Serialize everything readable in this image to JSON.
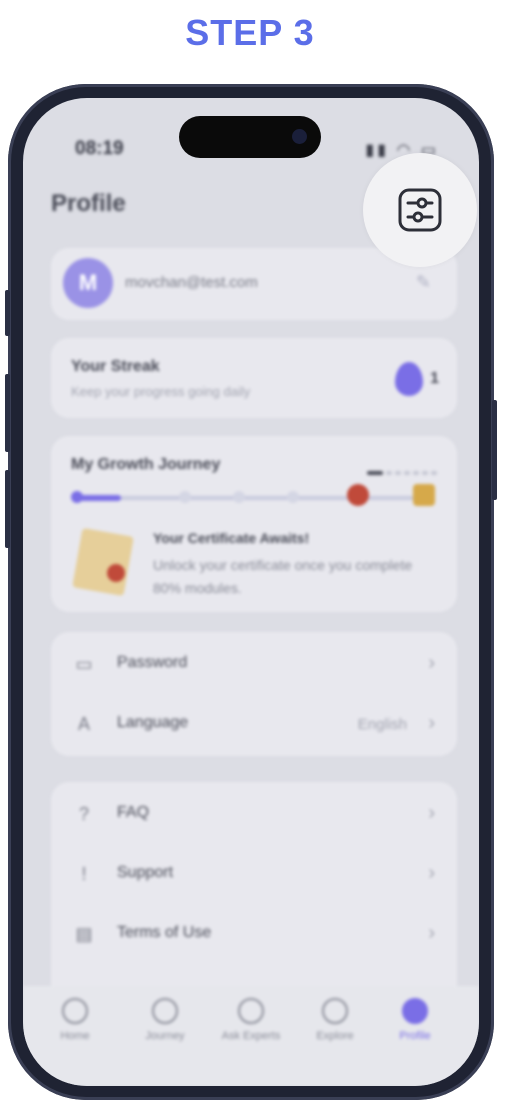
{
  "header": {
    "step_label": "STEP 3"
  },
  "status_bar": {
    "time": "08:19",
    "indicators": "signal wifi battery"
  },
  "profile": {
    "title": "Profile",
    "avatar_letter": "M",
    "email": "movchan@test.com"
  },
  "streak": {
    "title": "Your Streak",
    "subtitle": "Keep your progress going daily",
    "count": "1"
  },
  "growth": {
    "title": "My Growth Journey",
    "progress_fraction": 0.13,
    "certificate_title": "Your Certificate Awaits!",
    "certificate_text": "Unlock your certificate once you complete 80% modules."
  },
  "settings": {
    "items": [
      {
        "label": "Password",
        "icon": "password-icon",
        "value": ""
      },
      {
        "label": "Language",
        "icon": "translate-icon",
        "value": "English"
      }
    ]
  },
  "help": {
    "items": [
      {
        "label": "FAQ",
        "icon": "question-icon"
      },
      {
        "label": "Support",
        "icon": "support-icon"
      },
      {
        "label": "Terms of Use",
        "icon": "document-icon"
      }
    ]
  },
  "tabbar": {
    "tabs": [
      {
        "label": "Home",
        "icon": "home-icon"
      },
      {
        "label": "Journey",
        "icon": "journey-icon"
      },
      {
        "label": "Ask Experts",
        "icon": "experts-icon"
      },
      {
        "label": "Explore",
        "icon": "compass-icon"
      },
      {
        "label": "Profile",
        "icon": "user-icon",
        "active": true
      }
    ]
  },
  "highlight": {
    "icon": "filter-settings-icon"
  },
  "colors": {
    "accent": "#7a6ee6",
    "step": "#5b6ee8"
  }
}
